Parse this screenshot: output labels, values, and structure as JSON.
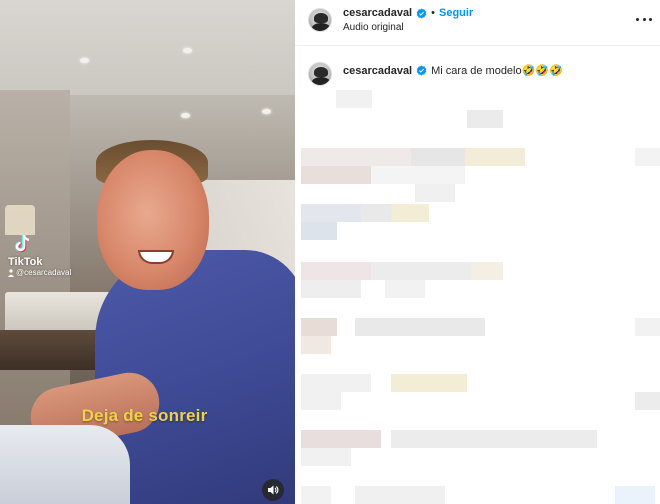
{
  "video": {
    "watermark_brand": "TikTok",
    "watermark_user": "@cesarcadaval",
    "caption": "Deja de sonreir"
  },
  "post": {
    "username": "cesarcadaval",
    "separator": "•",
    "follow_label": "Seguir",
    "audio_label": "Audio original",
    "caption_text": "Mi cara de modelo🤣🤣🤣"
  },
  "colors": {
    "follow_blue": "#0095f6",
    "caption_yellow": "#f0d24a",
    "verified_blue": "#0095f6"
  }
}
